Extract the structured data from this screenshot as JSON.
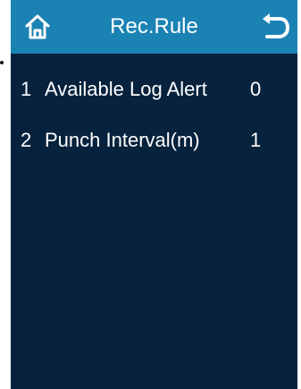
{
  "header": {
    "title": "Rec.Rule",
    "home_icon": "home-icon",
    "back_icon": "back-arrow-icon"
  },
  "rules": [
    {
      "index": "1",
      "label": "Available Log Alert",
      "value": "0"
    },
    {
      "index": "2",
      "label": "Punch Interval(m)",
      "value": "1"
    }
  ],
  "colors": {
    "header": "#1b82b4",
    "background": "#07223d",
    "text": "#ffffff"
  }
}
